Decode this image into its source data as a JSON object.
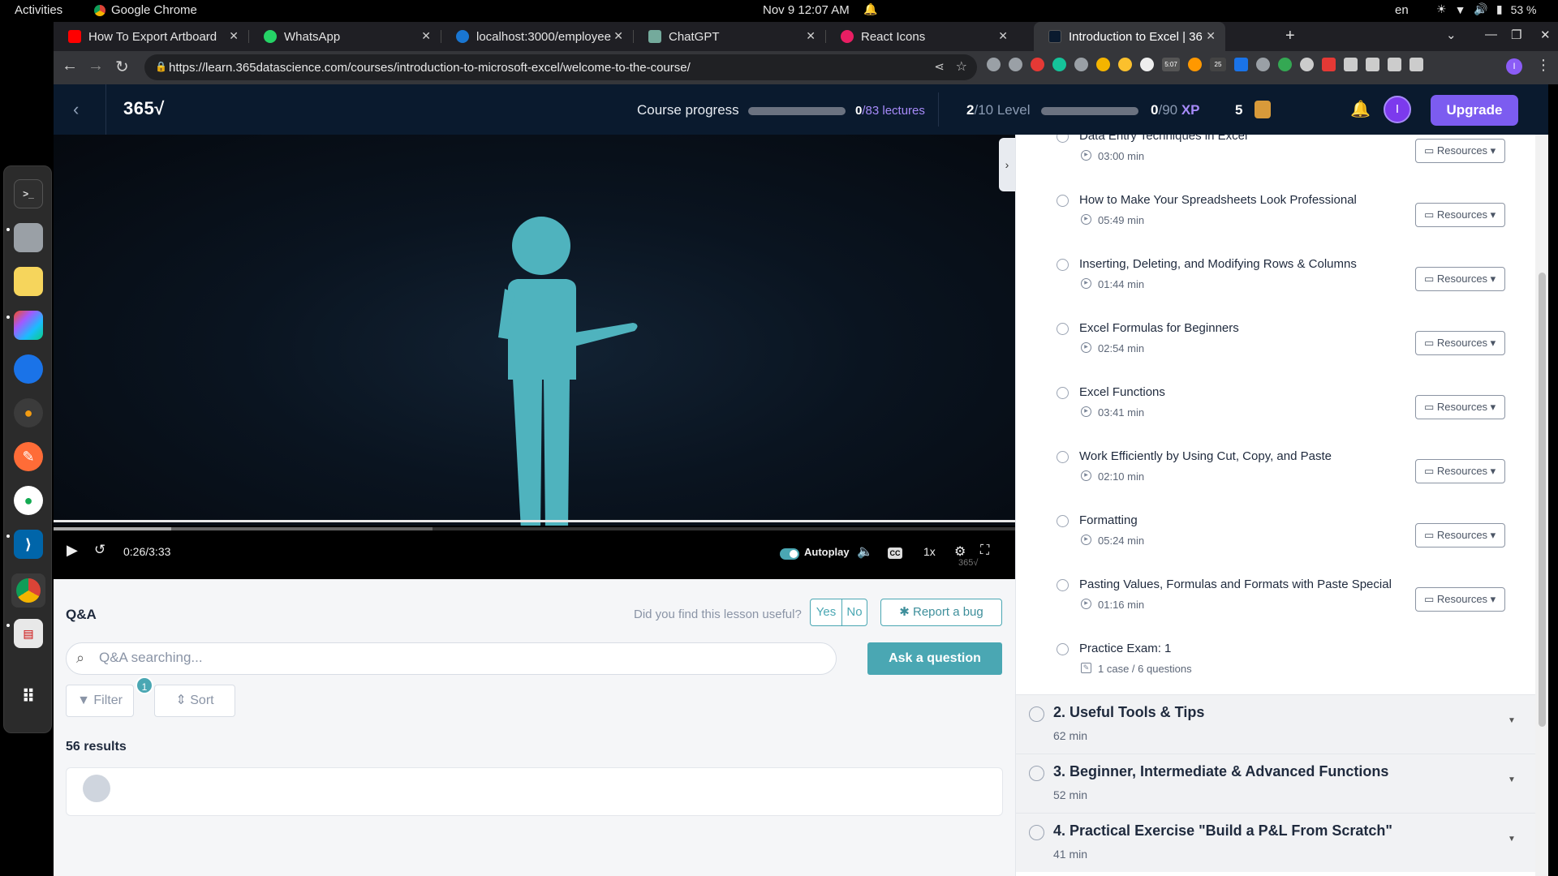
{
  "os": {
    "activities": "Activities",
    "app_name": "Google Chrome",
    "clock": "Nov 9  12:07 AM",
    "language": "en",
    "battery": "53 %"
  },
  "browser": {
    "tabs": [
      {
        "title": "How To Export Artboard",
        "favicon_color": "#ff0000",
        "active": false
      },
      {
        "title": "WhatsApp",
        "favicon_color": "#25d366",
        "active": false
      },
      {
        "title": "localhost:3000/employee",
        "favicon_color": "#1976d2",
        "active": false
      },
      {
        "title": "ChatGPT",
        "favicon_color": "#74aa9c",
        "active": false
      },
      {
        "title": "React Icons",
        "favicon_color": "#e91e63",
        "active": false
      },
      {
        "title": "Introduction to Excel | 36",
        "favicon_color": "#0a1a2e",
        "active": true
      }
    ],
    "new_tab": "+",
    "url": "https://learn.365datascience.com/courses/introduction-to-microsoft-excel/welcome-to-the-course/",
    "extension_badges": [
      "5:07",
      "25"
    ],
    "profile_initial": "I"
  },
  "header": {
    "logo": "365√",
    "course_progress_label": "Course progress",
    "lectures_done": "0",
    "lectures_total": "/83 lectures",
    "level_current": "2",
    "level_total": "/10 Level",
    "xp_current": "0",
    "xp_total": "/90",
    "xp_unit": "XP",
    "streak": "5",
    "avatar_initial": "I",
    "upgrade_label": "Upgrade",
    "course_progress_fraction": 0.0,
    "xp_fraction": 0.0
  },
  "player": {
    "time": "0:26/3:33",
    "autoplay_label": "Autoplay",
    "speed": "1x",
    "watermark": "365√",
    "played_fraction": 0.122
  },
  "qa": {
    "title": "Q&A",
    "useful_question": "Did you find this lesson useful?",
    "yes": "Yes",
    "no": "No",
    "report_bug": "Report a bug",
    "search_placeholder": "Q&A searching...",
    "ask_label": "Ask a question",
    "filter_label": "Filter",
    "filter_count": "1",
    "sort_label": "Sort",
    "results": "56 results"
  },
  "sidebar": {
    "lessons": [
      {
        "title": "Data Entry Techniques in Excel",
        "meta": "03:00 min",
        "resources": "Resources"
      },
      {
        "title": "How to Make Your Spreadsheets Look Professional",
        "meta": "05:49 min",
        "resources": "Resources"
      },
      {
        "title": "Inserting, Deleting, and Modifying Rows & Columns",
        "meta": "01:44 min",
        "resources": "Resources"
      },
      {
        "title": "Excel Formulas for Beginners",
        "meta": "02:54 min",
        "resources": "Resources"
      },
      {
        "title": "Excel Functions",
        "meta": "03:41 min",
        "resources": "Resources"
      },
      {
        "title": "Work Efficiently by Using Cut, Copy, and Paste",
        "meta": "02:10 min",
        "resources": "Resources"
      },
      {
        "title": "Formatting",
        "meta": "05:24 min",
        "resources": "Resources"
      },
      {
        "title": "Pasting Values, Formulas and Formats with Paste Special",
        "meta": "01:16 min",
        "resources": "Resources"
      },
      {
        "title": "Practice Exam: 1",
        "meta": "1 case / 6 questions",
        "resources": ""
      }
    ],
    "sections": [
      {
        "title": "2. Useful Tools & Tips",
        "duration": "62 min"
      },
      {
        "title": "3. Beginner, Intermediate & Advanced Functions",
        "duration": "52 min"
      },
      {
        "title": "4. Practical Exercise \"Build a P&L From Scratch\"",
        "duration": "41 min"
      }
    ]
  },
  "colors": {
    "teal": "#4aa7b3",
    "purple": "#7c5cf0",
    "header_bg": "#0a1a2e"
  }
}
